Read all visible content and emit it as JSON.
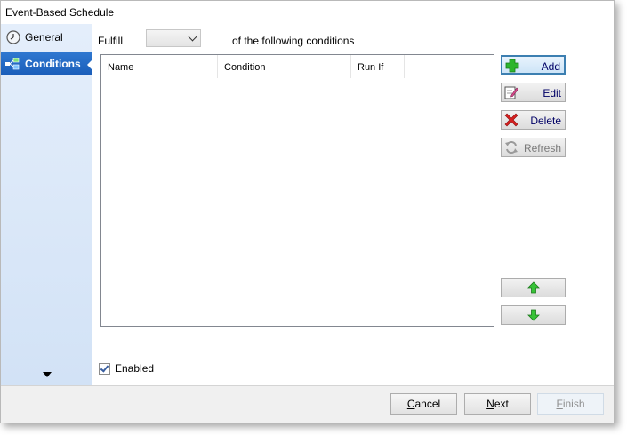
{
  "window": {
    "title": "Event-Based Schedule"
  },
  "sidebar": {
    "items": [
      {
        "label": "General",
        "icon": "clock-icon",
        "selected": false
      },
      {
        "label": "Conditions",
        "icon": "conditions-icon",
        "selected": true
      }
    ],
    "scroll_icon": "chevron-down-icon"
  },
  "conditions": {
    "fulfill_label": "Fulfill",
    "fulfill_value": "",
    "following_text": "of the following conditions",
    "columns": [
      "Name",
      "Condition",
      "Run If"
    ],
    "rows": []
  },
  "side_buttons": {
    "add": "Add",
    "edit": "Edit",
    "delete": "Delete",
    "refresh": "Refresh",
    "move_up_icon": "arrow-up-icon",
    "move_down_icon": "arrow-down-icon"
  },
  "enabled": {
    "label": "Enabled",
    "checked": true
  },
  "footer": {
    "cancel": "Cancel",
    "next": "Next",
    "finish": "Finish"
  },
  "colors": {
    "accent": "#1a5db9",
    "sidebar_bg": "#d2e2f6",
    "add_green": "#2db52d",
    "delete_red": "#d62020"
  }
}
